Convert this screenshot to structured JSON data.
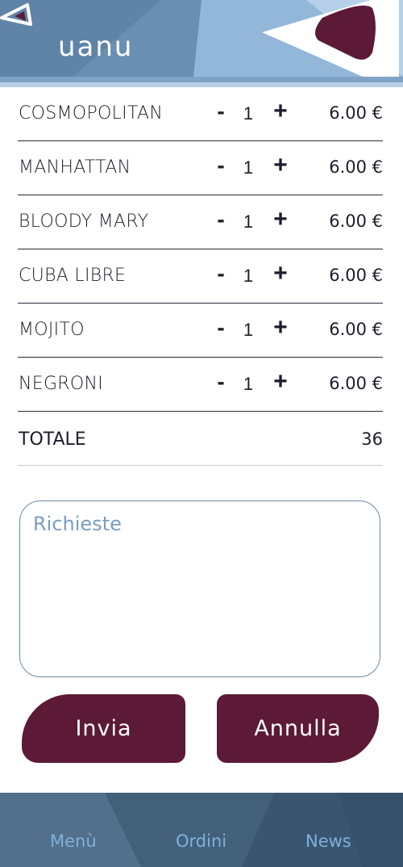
{
  "header": {
    "logo_text": "uanu",
    "colors": {
      "primary": "#5c1a36",
      "header_blue": "#7fa3c4"
    }
  },
  "order": {
    "items": [
      {
        "name": "COSMOPOLITAN",
        "minus": "-",
        "qty": "1",
        "plus": "+",
        "price": "6.00 €"
      },
      {
        "name": "MANHATTAN",
        "minus": "-",
        "qty": "1",
        "plus": "+",
        "price": "6.00 €"
      },
      {
        "name": "BLOODY MARY",
        "minus": "-",
        "qty": "1",
        "plus": "+",
        "price": "6.00 €"
      },
      {
        "name": "CUBA LIBRE",
        "minus": "-",
        "qty": "1",
        "plus": "+",
        "price": "6.00 €"
      },
      {
        "name": "MOJITO",
        "minus": "-",
        "qty": "1",
        "plus": "+",
        "price": "6.00 €"
      },
      {
        "name": "NEGRONI",
        "minus": "-",
        "qty": "1",
        "plus": "+",
        "price": "6.00 €"
      }
    ],
    "total_label": "TOTALE",
    "total_value": "36"
  },
  "notes": {
    "placeholder": "Richieste",
    "value": ""
  },
  "actions": {
    "send_label": "Invia",
    "cancel_label": "Annulla"
  },
  "nav": {
    "menu": "Menù",
    "orders": "Ordini",
    "news": "News"
  }
}
